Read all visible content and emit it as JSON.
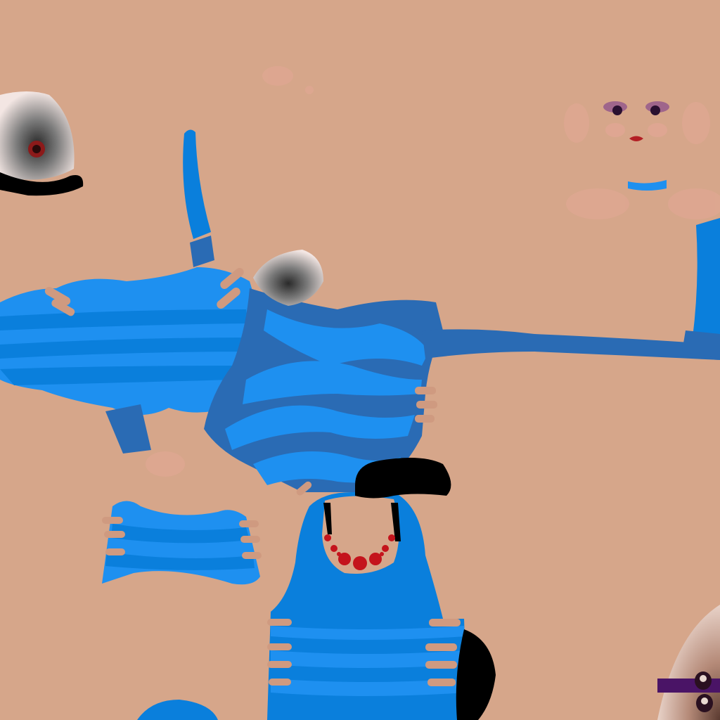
{
  "texture": {
    "kind": "character-uv-texture-atlas",
    "palette": {
      "skin": "#d6a68a",
      "skin_shadow": "#cf9a80",
      "blush": "#e3a796",
      "fabric_light": "#1e90f0",
      "fabric_mid": "#0a7fdc",
      "fabric_dark": "#2a6bb4",
      "hair": "#000000",
      "necklace": "#c4141c",
      "eye_white": "#f1e3e0",
      "eye_grey": "#6e6e6e",
      "iris_red": "#8c1a1a",
      "eyeshadow": "#7a3a8c",
      "lips": "#b31f24",
      "purple_trim": "#4a1466"
    },
    "regions": [
      "eye-texture",
      "fabric-top-left",
      "fabric-strap",
      "fabric-body-center",
      "fabric-right-arm",
      "fabric-left-lower",
      "fabric-center-lower",
      "hair-patch",
      "necklace",
      "face-details",
      "corner-fan-eyes"
    ]
  }
}
